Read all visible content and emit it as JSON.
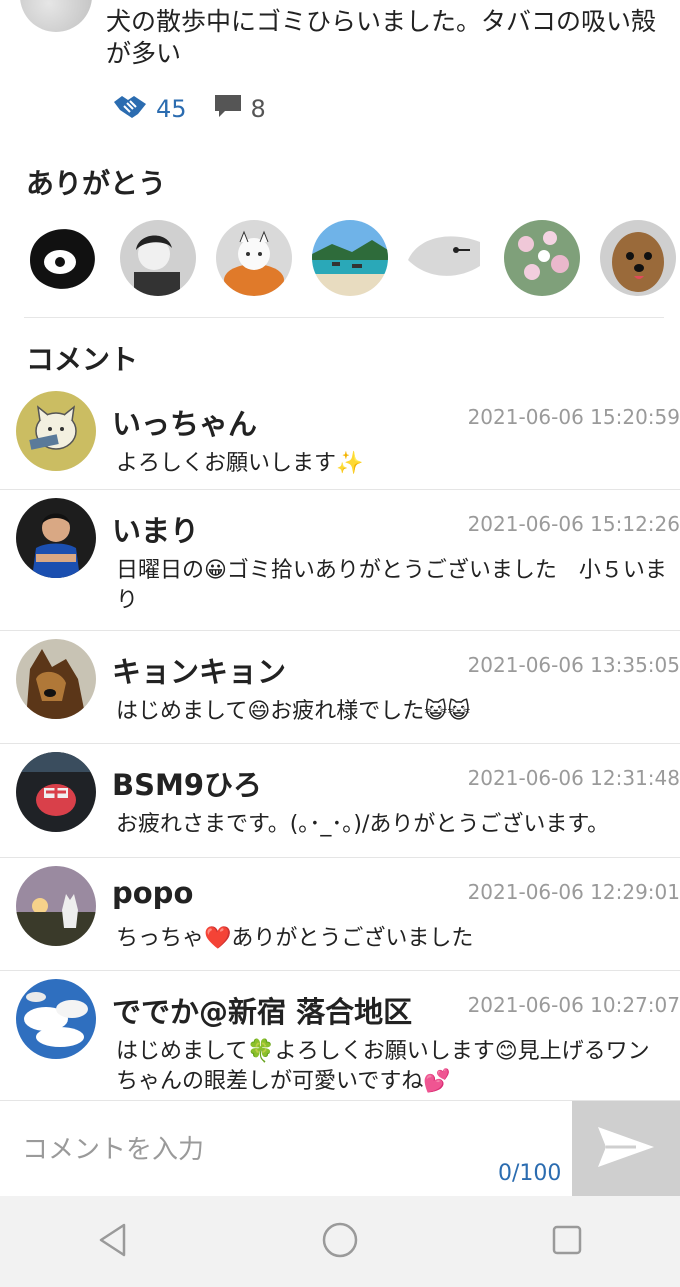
{
  "post": {
    "text": "犬の散歩中にゴミひらいました。タバコの吸い殻が多い",
    "thanks_count": "45",
    "comment_count": "8",
    "accent_color": "#2b6cb0"
  },
  "thanks_section": {
    "title": "ありがとう"
  },
  "comments_section": {
    "title": "コメント",
    "items": [
      {
        "name": "いっちゃん",
        "time": "2021-06-06 15:20:59",
        "body": "よろしくお願いします✨"
      },
      {
        "name": "いまり",
        "time": "2021-06-06 15:12:26",
        "body": "日曜日の😀ゴミ拾いありがとうございました　小５いまり"
      },
      {
        "name": "キョンキョン",
        "time": "2021-06-06 13:35:05",
        "body": "はじめまして😄お疲れ様でした😺😺"
      },
      {
        "name": "BSM9ひろ",
        "time": "2021-06-06 12:31:48",
        "body": "お疲れさまです。(｡･_･｡)/ありがとうございます。"
      },
      {
        "name": "popo",
        "time": "2021-06-06 12:29:01",
        "body": "ちっちゃ❤️ありがとうございました"
      },
      {
        "name": "ででか@新宿 落合地区",
        "time": "2021-06-06 10:27:07",
        "body": "はじめまして🍀よろしくお願いします😊見上げるワンちゃんの眼差しが可愛いですね💕"
      }
    ]
  },
  "comment_input": {
    "placeholder": "コメントを入力",
    "counter": "0/100"
  },
  "icons": {
    "thanks": "handshake-icon",
    "comments": "speech-bubble-icon",
    "send": "send-icon",
    "nav_back": "triangle-back-icon",
    "nav_home": "circle-home-icon",
    "nav_recent": "square-recent-icon"
  }
}
